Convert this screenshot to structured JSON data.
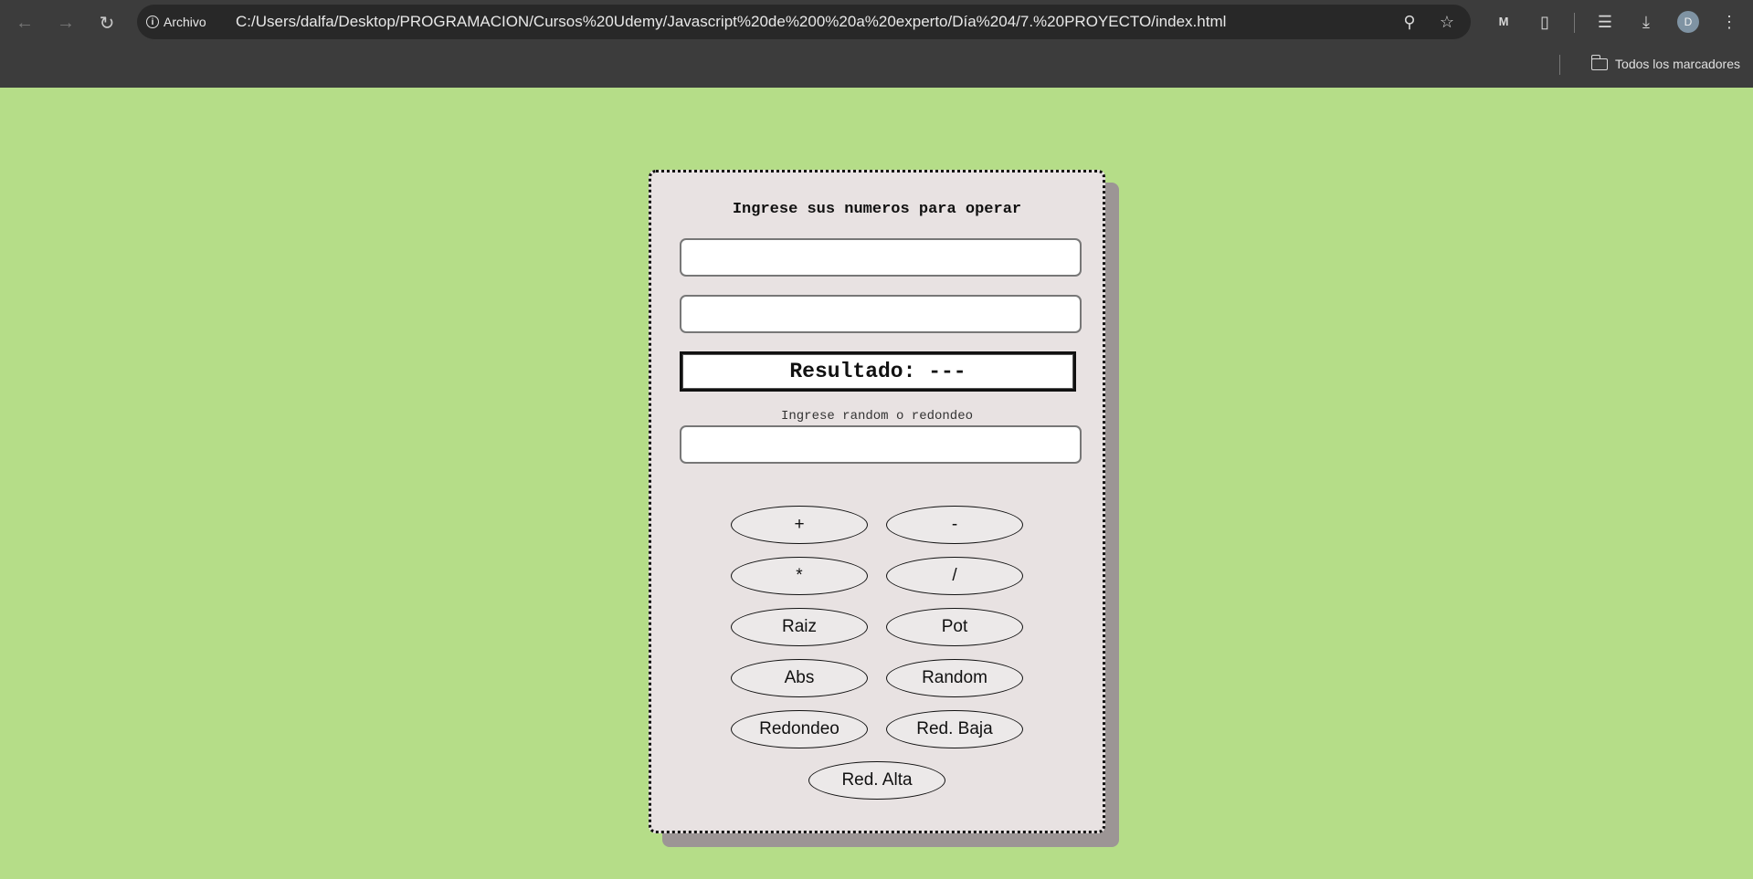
{
  "browser": {
    "site_chip_label": "Archivo",
    "url": "C:/Users/dalfa/Desktop/PROGRAMACION/Cursos%20Udemy/Javascript%20de%200%20a%20experto/Día%204/7.%20PROYECTO/index.html",
    "avatar_initial": "D",
    "bookmarks_label": "Todos los marcadores"
  },
  "calculator": {
    "title": "Ingrese sus numeros para operar",
    "input1_value": "",
    "input2_value": "",
    "result_text": "Resultado: ---",
    "random_hint": "Ingrese random o redondeo",
    "input3_value": "",
    "buttons": {
      "add": "+",
      "subtract": "-",
      "multiply": "*",
      "divide": "/",
      "sqrt": "Raiz",
      "pow": "Pot",
      "abs": "Abs",
      "random": "Random",
      "round": "Redondeo",
      "floor": "Red. Baja",
      "ceil": "Red. Alta"
    }
  },
  "colors": {
    "page_background": "#b5dd88",
    "card_background": "#e8e2e2",
    "card_shadow": "#9c9595",
    "chrome_background": "#3c3c3c"
  }
}
